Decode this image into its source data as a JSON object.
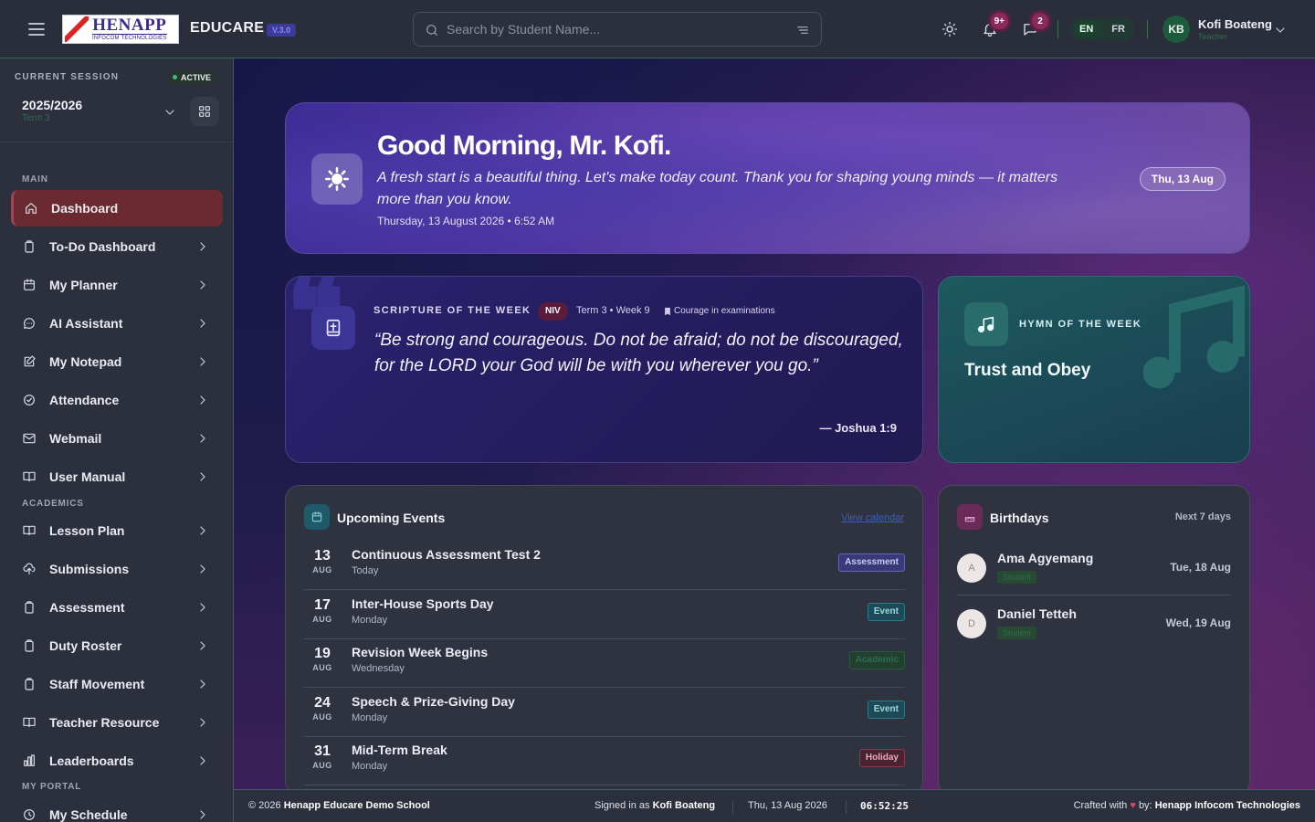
{
  "header": {
    "logo_big": "HENAPP",
    "logo_small": "INFOCOM TECHNOLOGIES",
    "app_name": "EDUCARE",
    "version": "V.3.0",
    "search_placeholder": "Search by Student Name...",
    "notifications_badge": "9+",
    "messages_badge": "2",
    "lang_en": "EN",
    "lang_fr": "FR",
    "user_initials": "KB",
    "user_name": "Kofi Boateng",
    "user_role": "Teacher"
  },
  "session": {
    "label": "CURRENT SESSION",
    "status": "ACTIVE",
    "year": "2025/2026",
    "term": "Term 3"
  },
  "sidebar": {
    "sections": {
      "main": "MAIN",
      "academics": "ACADEMICS",
      "portal": "MY PORTAL"
    },
    "items": [
      {
        "label": "Dashboard",
        "icon": "home-icon"
      },
      {
        "label": "To-Do Dashboard",
        "icon": "clipboard-icon"
      },
      {
        "label": "My Planner",
        "icon": "calendar-icon"
      },
      {
        "label": "AI Assistant",
        "icon": "chat-icon"
      },
      {
        "label": "My Notepad",
        "icon": "edit-icon"
      },
      {
        "label": "Attendance",
        "icon": "check-circle-icon"
      },
      {
        "label": "Webmail",
        "icon": "mail-icon"
      },
      {
        "label": "User Manual",
        "icon": "book-icon"
      },
      {
        "label": "Lesson Plan",
        "icon": "book-icon"
      },
      {
        "label": "Submissions",
        "icon": "upload-icon"
      },
      {
        "label": "Assessment",
        "icon": "clipboard-icon"
      },
      {
        "label": "Duty Roster",
        "icon": "clipboard-icon"
      },
      {
        "label": "Staff Movement",
        "icon": "clipboard-icon"
      },
      {
        "label": "Teacher Resource",
        "icon": "book-icon"
      },
      {
        "label": "Leaderboards",
        "icon": "bar-chart-icon"
      },
      {
        "label": "My Schedule",
        "icon": "clock-icon"
      }
    ]
  },
  "hero": {
    "greeting": "Good Morning, Mr. Kofi.",
    "quote": "A fresh start is a beautiful thing. Let's make today count. Thank you for shaping young minds — it matters more than you know.",
    "datetime": "Thursday, 13 August 2026 • 6:52 AM",
    "date_pill": "Thu, 13 Aug"
  },
  "scripture": {
    "label": "SCRIPTURE OF THE WEEK",
    "version": "NIV",
    "term_week": "Term 3 • Week 9",
    "theme": "Courage in examinations",
    "verse": "“Be strong and courageous. Do not be afraid; do not be discouraged, for the LORD your God will be with you wherever you go.”",
    "reference": "— Joshua 1:9"
  },
  "hymn": {
    "label": "HYMN OF THE WEEK",
    "title": "Trust and Obey"
  },
  "events": {
    "title": "Upcoming Events",
    "link": "View calendar",
    "items": [
      {
        "day": "13",
        "month": "AUG",
        "title": "Continuous Assessment Test 2",
        "sub": "Today",
        "tag": "Assessment"
      },
      {
        "day": "17",
        "month": "AUG",
        "title": "Inter-House Sports Day",
        "sub": "Monday",
        "tag": "Event"
      },
      {
        "day": "19",
        "month": "AUG",
        "title": "Revision Week Begins",
        "sub": "Wednesday",
        "tag": "Academic"
      },
      {
        "day": "24",
        "month": "AUG",
        "title": "Speech & Prize-Giving Day",
        "sub": "Monday",
        "tag": "Event"
      },
      {
        "day": "31",
        "month": "AUG",
        "title": "Mid-Term Break",
        "sub": "Monday",
        "tag": "Holiday"
      }
    ]
  },
  "birthdays": {
    "title": "Birthdays",
    "note": "Next 7 days",
    "items": [
      {
        "initial": "A",
        "name": "Ama Agyemang",
        "role": "Student",
        "date": "Tue, 18 Aug"
      },
      {
        "initial": "D",
        "name": "Daniel Tetteh",
        "role": "Student",
        "date": "Wed, 19 Aug"
      }
    ]
  },
  "footer": {
    "copyright_prefix": "© 2026",
    "school": "Henapp Educare Demo School",
    "signed_prefix": "Signed in as",
    "signed_user": "Kofi Boateng",
    "date": "Thu, 13 Aug 2026",
    "time": "06:52:25",
    "crafted_prefix": "Crafted with",
    "crafted_by": "by:",
    "company": "Henapp Infocom Technologies"
  },
  "colors": {
    "active_nav": "#6a2a30",
    "accent_green": "#1e5a3e",
    "hero_purple": "#4a3aa8",
    "hymn_teal": "#1d5a5e"
  }
}
